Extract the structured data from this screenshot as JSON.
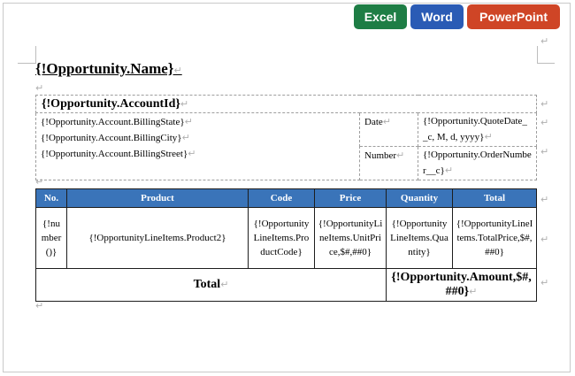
{
  "toolbar": {
    "excel_label": "Excel",
    "word_label": "Word",
    "powerpoint_label": "PowerPoint",
    "colors": {
      "excel": "#1e7d45",
      "word": "#2a5bb5",
      "powerpoint": "#cf4526"
    }
  },
  "document": {
    "paragraph_mark": "↵",
    "title": "{!Opportunity.Name}",
    "account": {
      "header": "{!Opportunity.AccountId}",
      "billing_state": "{!Opportunity.Account.BillingState}",
      "billing_city": "{!Opportunity.Account.BillingCity}",
      "billing_street": "{!Opportunity.Account.BillingStreet}",
      "date_label": "Date",
      "date_value": "{!Opportunity.QuoteDate__c, M, d, yyyy}",
      "number_label": "Number",
      "number_value": "{!Opportunity.OrderNumber__c}"
    },
    "items": {
      "header_color": "#3a74b9",
      "columns": [
        "No.",
        "Product",
        "Code",
        "Price",
        "Quantity",
        "Total"
      ],
      "row": [
        "{!number()}",
        "{!OpportunityLineItems.Product2}",
        "{!OpportunityLineItems.ProductCode}",
        "{!OpportunityLineItems.UnitPrice,$#,##0}",
        "{!OpportunityLineItems.Quantity}",
        "{!OpportunityLineItems.TotalPrice,$#,##0}"
      ],
      "total_label": "Total",
      "total_value": "{!Opportunity.Amount,$#,##0}"
    }
  }
}
